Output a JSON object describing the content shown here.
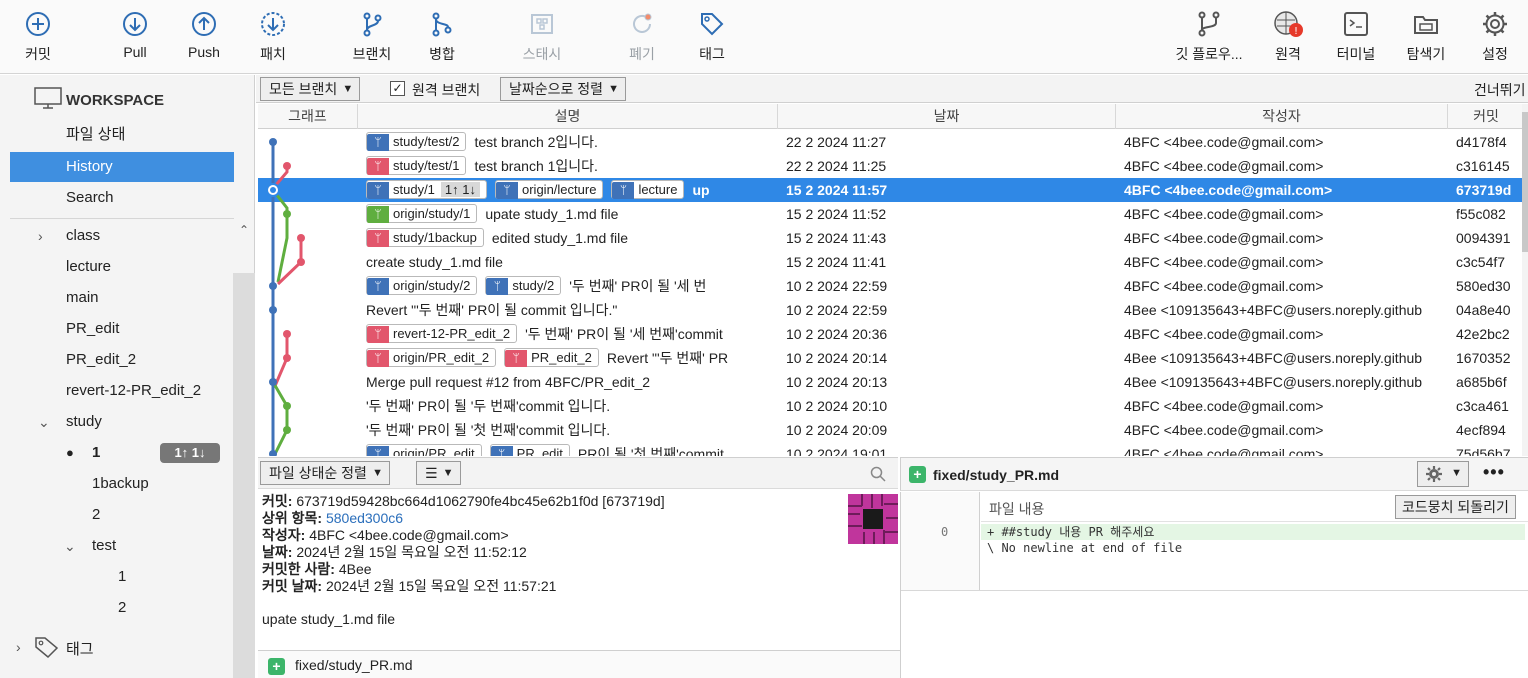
{
  "toolbar": {
    "left": [
      {
        "icon": "commit-icon",
        "label": "커밋"
      },
      {
        "icon": "pull-icon",
        "label": "Pull"
      },
      {
        "icon": "push-icon",
        "label": "Push"
      },
      {
        "icon": "fetch-icon",
        "label": "패치"
      },
      {
        "icon": "branch-icon",
        "label": "브랜치"
      },
      {
        "icon": "merge-icon",
        "label": "병합"
      },
      {
        "icon": "stash-icon",
        "label": "스태시"
      },
      {
        "icon": "discard-icon",
        "label": "폐기"
      },
      {
        "icon": "tag-icon",
        "label": "태그"
      }
    ],
    "right": [
      {
        "icon": "git-flow-icon",
        "label": "깃 플로우..."
      },
      {
        "icon": "remote-icon",
        "label": "원격"
      },
      {
        "icon": "terminal-icon",
        "label": "터미널"
      },
      {
        "icon": "explorer-icon",
        "label": "탐색기"
      },
      {
        "icon": "settings-icon",
        "label": "설정"
      }
    ]
  },
  "sidebar": {
    "workspace": "WORKSPACE",
    "items": [
      "파일 상태",
      "History",
      "Search"
    ],
    "branches": [
      "class",
      "lecture",
      "main",
      "PR_edit",
      "PR_edit_2",
      "revert-12-PR_edit_2"
    ],
    "study": {
      "label": "study",
      "children": [
        "1",
        "1backup",
        "2"
      ],
      "current_badge": "1↑ 1↓"
    },
    "test": {
      "label": "test",
      "children": [
        "1",
        "2"
      ]
    },
    "tags": "태그"
  },
  "filter": {
    "branches_dd": "모든 브랜치",
    "remote_branches": "원격 브랜치",
    "sort_dd": "날짜순으로 정렬",
    "skip": "건너뛰기"
  },
  "columns": {
    "graph": "그래프",
    "desc": "설명",
    "date": "날짜",
    "author": "작성자",
    "commit": "커밋"
  },
  "commits": [
    {
      "tags": [
        {
          "c": "blue",
          "t": "study/test/2"
        }
      ],
      "msg": "test branch 2입니다.",
      "date": "22 2 2024 11:27",
      "author": "4BFC <4bee.code@gmail.com>",
      "hash": "d4178f4"
    },
    {
      "tags": [
        {
          "c": "red",
          "t": "study/test/1"
        }
      ],
      "msg": "test branch 1입니다.",
      "date": "22 2 2024 11:25",
      "author": "4BFC <4bee.code@gmail.com>",
      "hash": "c316145"
    },
    {
      "tags": [
        {
          "c": "blue",
          "t": "study/1",
          "n": "1↑ 1↓"
        },
        {
          "c": "blue",
          "t": "origin/lecture"
        },
        {
          "c": "blue",
          "t": "lecture"
        }
      ],
      "msg": "up",
      "date": "15 2 2024 11:57",
      "author": "4BFC <4bee.code@gmail.com>",
      "hash": "673719d",
      "selected": true
    },
    {
      "tags": [
        {
          "c": "green",
          "t": "origin/study/1"
        }
      ],
      "msg": "upate study_1.md file",
      "date": "15 2 2024 11:52",
      "author": "4BFC <4bee.code@gmail.com>",
      "hash": "f55c082"
    },
    {
      "tags": [
        {
          "c": "red",
          "t": "study/1backup"
        }
      ],
      "msg": "edited study_1.md file",
      "date": "15 2 2024 11:43",
      "author": "4BFC <4bee.code@gmail.com>",
      "hash": "0094391"
    },
    {
      "tags": [],
      "msg": "create study_1.md file",
      "date": "15 2 2024 11:41",
      "author": "4BFC <4bee.code@gmail.com>",
      "hash": "c3c54f7"
    },
    {
      "tags": [
        {
          "c": "blue",
          "t": "origin/study/2"
        },
        {
          "c": "blue",
          "t": "study/2"
        }
      ],
      "msg": "'두 번째' PR이 될 '세 번",
      "date": "10 2 2024 22:59",
      "author": "4BFC <4bee.code@gmail.com>",
      "hash": "580ed30"
    },
    {
      "tags": [],
      "msg": "Revert \"'두 번째' PR이 될 commit 입니다.\"",
      "date": "10 2 2024 22:59",
      "author": "4Bee <109135643+4BFC@users.noreply.github",
      "hash": "04a8e40"
    },
    {
      "tags": [
        {
          "c": "red",
          "t": "revert-12-PR_edit_2"
        }
      ],
      "msg": "'두 번째' PR이 될 '세 번째'commit",
      "date": "10 2 2024 20:36",
      "author": "4BFC <4bee.code@gmail.com>",
      "hash": "42e2bc2"
    },
    {
      "tags": [
        {
          "c": "red",
          "t": "origin/PR_edit_2"
        },
        {
          "c": "red",
          "t": "PR_edit_2"
        }
      ],
      "msg": "Revert \"'두 번째' PR",
      "date": "10 2 2024 20:14",
      "author": "4Bee <109135643+4BFC@users.noreply.github",
      "hash": "1670352"
    },
    {
      "tags": [],
      "msg": "Merge pull request #12 from 4BFC/PR_edit_2",
      "date": "10 2 2024 20:13",
      "author": "4Bee <109135643+4BFC@users.noreply.github",
      "hash": "a685b6f"
    },
    {
      "tags": [],
      "msg": "'두 번째' PR이 될 '두 번째'commit 입니다.",
      "date": "10 2 2024 20:10",
      "author": "4BFC <4bee.code@gmail.com>",
      "hash": "c3ca461"
    },
    {
      "tags": [],
      "msg": "'두 번째' PR이 될 '첫 번째'commit 입니다.",
      "date": "10 2 2024 20:09",
      "author": "4BFC <4bee.code@gmail.com>",
      "hash": "4ecf894"
    },
    {
      "tags": [
        {
          "c": "blue",
          "t": "origin/PR_edit"
        },
        {
          "c": "blue",
          "t": "PR_edit"
        }
      ],
      "msg": "PR이 될 '첫 번째'commit",
      "date": "10 2 2024 19:01",
      "author": "4BFC <4bee.code@gmail.com>",
      "hash": "75d56b7"
    }
  ],
  "bottom_left": {
    "sort_dd": "파일 상태순 정렬",
    "list_dd": "☰",
    "commit_label": "커밋:",
    "commit_value": "673719d59428bc664d1062790fe4bc45e62b1f0d [673719d]",
    "parent_label": "상위 항목:",
    "parent_value": "580ed300c6",
    "author_label": "작성자:",
    "author_value": "4BFC <4bee.code@gmail.com>",
    "date_label": "날짜:",
    "date_value": "2024년 2월 15일 목요일 오전 11:52:12",
    "committer_label": "커밋한 사람:",
    "committer_value": "4Bee",
    "commit_date_label": "커밋 날짜:",
    "commit_date_value": "2024년 2월 15일 목요일 오전 11:57:21",
    "message": "upate study_1.md file",
    "file": "fixed/study_PR.md"
  },
  "bottom_right": {
    "file": "fixed/study_PR.md",
    "content_label": "파일 내용",
    "revert_button": "코드뭉치 되돌리기",
    "line_no": "0",
    "line1": "+ ##study 내용 PR 해주세요",
    "line2": "\\ No newline at end of file"
  },
  "colors": {
    "selection": "#2f88e6",
    "branch_blue": "#3f72b8",
    "branch_red": "#e2566c",
    "branch_green": "#5fae3f"
  }
}
